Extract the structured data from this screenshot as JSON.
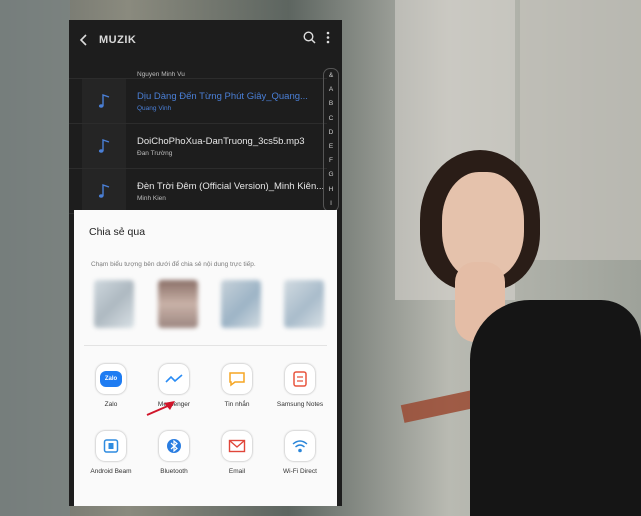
{
  "app": {
    "title": "MUZIK",
    "back_icon": "back-arrow-icon",
    "search_icon": "search-icon",
    "more_icon": "more-vert-icon"
  },
  "songs": [
    {
      "title": "",
      "artist": "Nguyen Minh Vu",
      "partial": true
    },
    {
      "title": "Dịu Dàng Đến Từng Phút Giây_Quang...",
      "artist": "Quang Vinh",
      "active": true
    },
    {
      "title": "DoiChoPhoXua-DanTruong_3cs5b.mp3",
      "artist": "Đan Trường"
    },
    {
      "title": "Đèn Trời Đêm (Official Version)_Minh Kiên...",
      "artist": "Minh Kien"
    }
  ],
  "index_letters": [
    "&",
    "A",
    "B",
    "C",
    "D",
    "E",
    "F",
    "G",
    "H",
    "I"
  ],
  "share": {
    "title": "Chia sẻ qua",
    "hint": "Chạm biểu tượng bên dưới để chia sẻ nội dung trực tiếp.",
    "apps": [
      {
        "label": "Zalo",
        "icon": "zalo-icon",
        "icon_text": "Zalo",
        "color": "#1e7cf2"
      },
      {
        "label": "Messenger",
        "icon": "messenger-icon",
        "color": "#2a8cf5"
      },
      {
        "label": "Tin nhắn",
        "icon": "message-icon",
        "color": "#f5a623"
      },
      {
        "label": "Samsung Notes",
        "icon": "samsung-notes-icon",
        "color": "#e8553e"
      },
      {
        "label": "Android Beam",
        "icon": "android-beam-icon",
        "color": "#2f8ce0"
      },
      {
        "label": "Bluetooth",
        "icon": "bluetooth-icon",
        "color": "#2a7de1"
      },
      {
        "label": "Email",
        "icon": "email-icon",
        "color": "#e0463a"
      },
      {
        "label": "Wi-Fi Direct",
        "icon": "wifi-direct-icon",
        "color": "#2b86d9"
      }
    ]
  },
  "colors": {
    "accent": "#4a7fd6",
    "dark_bg": "#1d1d1d",
    "sheet_bg": "#fafafa",
    "annotation": "#d0152a"
  }
}
